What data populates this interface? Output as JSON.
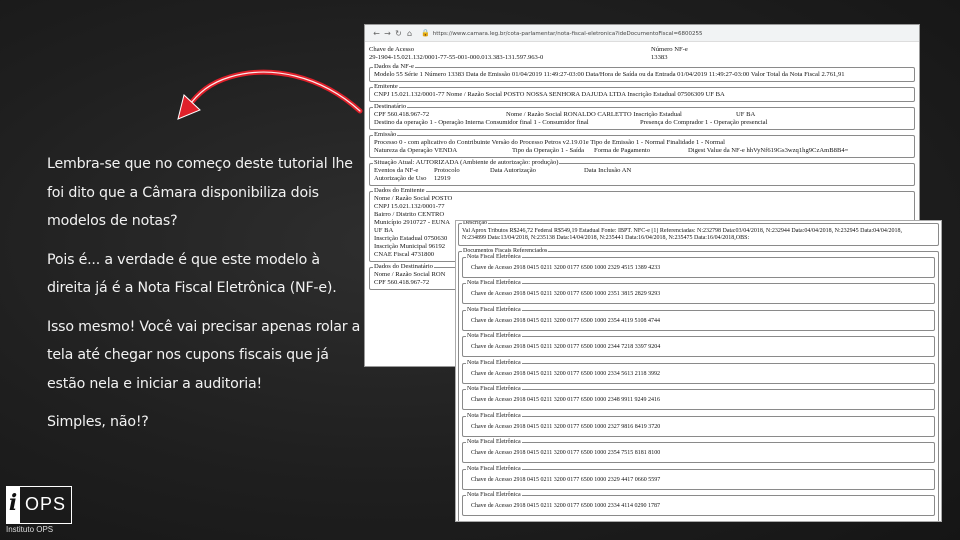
{
  "slide": {
    "paragraphs": [
      "Lembra-se que no começo deste tutorial lhe foi dito que a Câmara disponibiliza dois modelos de notas?",
      "Pois é... a verdade é que este modelo à direita já é a Nota Fiscal Eletrônica (NF-e).",
      "Isso mesmo! Você vai precisar apenas rolar a tela até chegar nos cupons fiscais que já estão nela e iniciar a auditoria!",
      "Simples, não!?"
    ],
    "arrow_color": "#e0202a"
  },
  "browser": {
    "url": "https://www.camara.leg.br/cota-parlamentar/nota-fiscal-eletronica?ideDocumentoFiscal=6800255"
  },
  "nfe": {
    "chave_label": "Chave de Acesso",
    "chave_value": "29-1904-15.021.132/0001-77-55-001-000.013.383-131.597.963-0",
    "numero_label": "Número NF-e",
    "numero_value": "13383",
    "dados_legend": "Dados da NF-e",
    "dados_line": "Modelo 55 Série 1 Número 13383 Data de Emissão 01/04/2019 11:49:27-03:00 Data/Hora de Saída ou da Entrada 01/04/2019 11:49:27-03:00 Valor Total da Nota Fiscal   2.761,91",
    "emitente_legend": "Emitente",
    "emitente_line": "CNPJ 15.021.132/0001-77 Nome / Razão Social POSTO NOSSA SENHORA DAJUDA LTDA Inscrição Estadual 07506309 UF BA",
    "dest_legend": "Destinatário",
    "dest_line1_a": "CPF 560.418.967-72",
    "dest_line1_b": "Nome / Razão Social RONALDO CARLETTO Inscrição Estadual",
    "dest_line1_c": "UF BA",
    "dest_line2_a": "Destino da operação 1 - Operação Interna Consumidor final 1 - Consumidor final",
    "dest_line2_b": "Presença do Comprador 1 - Operação presencial",
    "emissao_legend": "Emissão",
    "emissao_line1": "Processo 0 - com aplicativo do Contribuinte Versão do Processo Petros v2.19.01e Tipo de Emissão 1 - Normal Finalidade 1 - Normal",
    "emissao_line2_a": "Natureza da Operação VENDA",
    "emissao_line2_b": "Tipo da Operação 1 - Saída",
    "emissao_line2_c": "Forma de Pagamento",
    "emissao_line2_d": "Digest Value da NF-e hhVyNf619Gs3wzq1hg9CzAmB8B4=",
    "situacao_legend": "Situação Atual: AUTORIZADA (Ambiente de autorização: produção)",
    "eventos_h1": "Eventos da NF-e",
    "eventos_h2": "Protocolo",
    "eventos_h3": "Data Autorização",
    "eventos_h4": "Data Inclusão AN",
    "eventos_r1": "Autorização de Uso",
    "eventos_r2": "12919",
    "emit2_legend": "Dados do Emitente",
    "emit2_lines": [
      "Nome / Razão Social POSTO",
      "CNPJ 15.021.132/0001-77",
      "Bairro / Distrito CENTRO",
      "Município 2910727 - EUNA",
      "UF BA",
      "Inscrição Estadual 0750630",
      "Inscrição Municipal 96192",
      "CNAE Fiscal 4731800"
    ],
    "dest2_legend": "Dados do Destinatário",
    "dest2_lines": [
      "Nome / Razão Social RON",
      "CPF 560.418.967-72"
    ]
  },
  "overlay": {
    "desc_legend": "Descrição",
    "desc_line1": "Val Aprox Tributos R$246,72 Federal R$549,19 Estadual Fonte: IBPT. NFC-e [1] Referenciadas: N:232798 Data:03/04/2018, N:232944 Data:04/04/2018, N:232945 Data:04/04/2018,",
    "desc_line2": "N:234899 Data:13/04/2018, N:235138 Data:14/04/2018, N:235441 Data:16/04/2018, N:235475 Data:16/04/2018,OBS:",
    "refs_legend": "Documentos Fiscais Referenciados",
    "nf_legend": "Nota Fiscal Eletrônica",
    "chaves": [
      "Chave de Acesso 2918 0415 0211 3200 0177 6500 1000 2329 4515 1389 4233",
      "Chave de Acesso 2918 0415 0211 3200 0177 6500 1000 2351 3815 2829 9293",
      "Chave de Acesso 2918 0415 0211 3200 0177 6500 1000 2354 4119 5108 4744",
      "Chave de Acesso 2918 0415 0211 3200 0177 6500 1000 2344 7218 3397 9204",
      "Chave de Acesso 2918 0415 0211 3200 0177 6500 1000 2334 5613 2118 3992",
      "Chave de Acesso 2918 0415 0211 3200 0177 6500 1000 2348 9911 9249 2416",
      "Chave de Acesso 2918 0415 0211 3200 0177 6500 1000 2327 9816 8419 3720",
      "Chave de Acesso 2918 0415 0211 3200 0177 6500 1000 2354 7515 8181 8100",
      "Chave de Acesso 2918 0415 0211 3200 0177 6500 1000 2329 4417 0660 5597",
      "Chave de Acesso 2918 0415 0211 3200 0177 6500 1000 2334 4114 0290 1787"
    ]
  },
  "logo": {
    "mark_i": "i",
    "mark_ops": "OPS",
    "caption": "Instituto OPS"
  }
}
